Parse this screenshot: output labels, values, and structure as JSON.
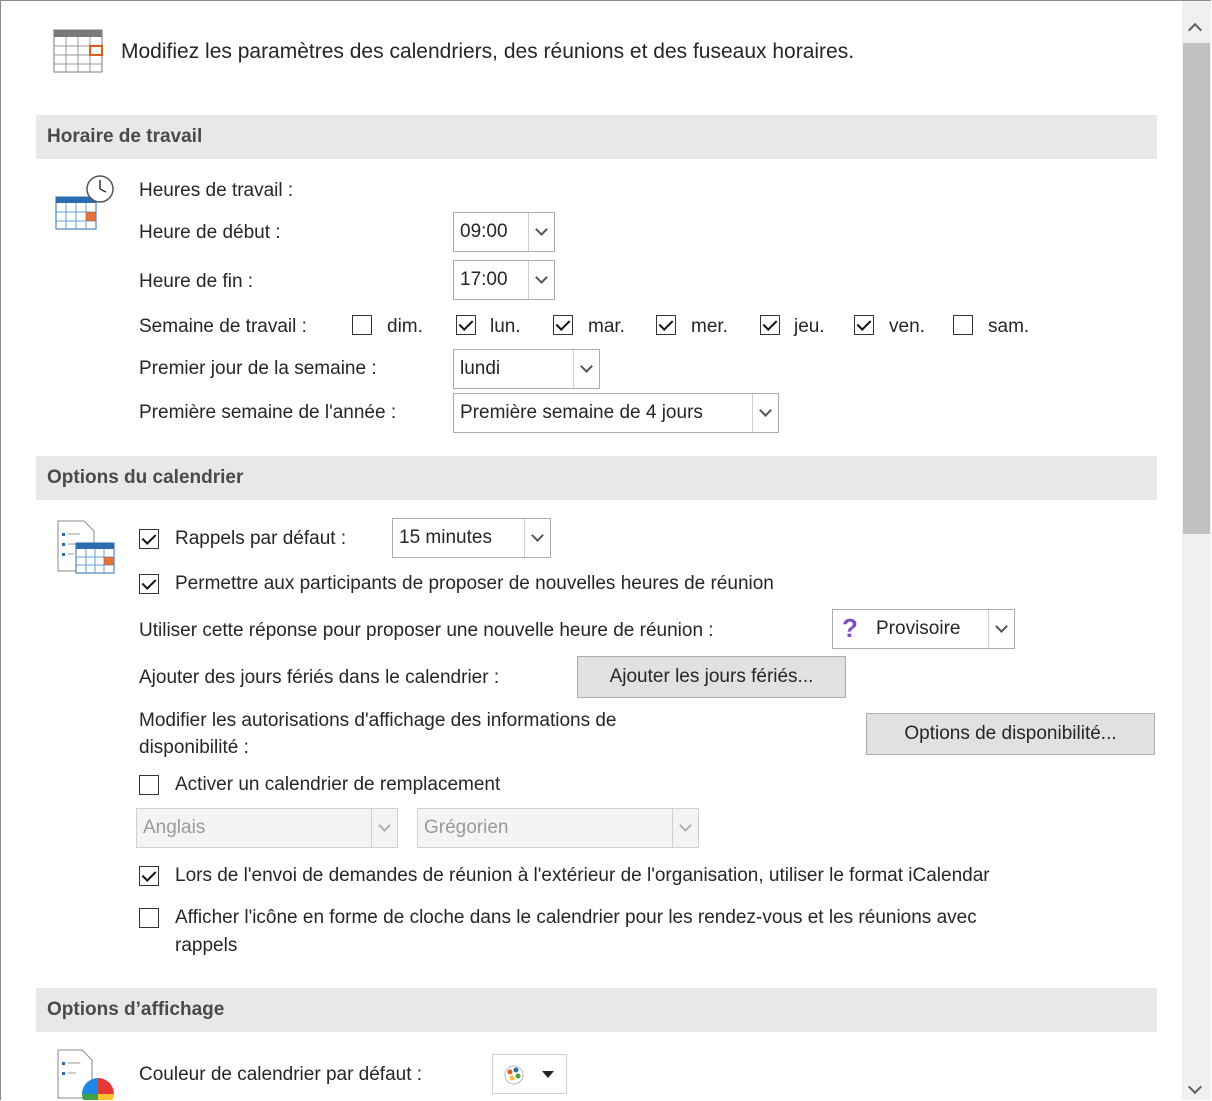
{
  "intro": "Modifiez les paramètres des calendriers, des réunions et des fuseaux horaires.",
  "work": {
    "header": "Horaire de travail",
    "hours_label": "Heures de travail :",
    "start_label": "Heure de début :",
    "start_value": "09:00",
    "end_label": "Heure de fin :",
    "end_value": "17:00",
    "week_label": "Semaine de travail :",
    "days": [
      {
        "label": "dim.",
        "checked": false
      },
      {
        "label": "lun.",
        "checked": true
      },
      {
        "label": "mar.",
        "checked": true
      },
      {
        "label": "mer.",
        "checked": true
      },
      {
        "label": "jeu.",
        "checked": true
      },
      {
        "label": "ven.",
        "checked": true
      },
      {
        "label": "sam.",
        "checked": false
      }
    ],
    "first_day_label": "Premier jour de la semaine :",
    "first_day_value": "lundi",
    "first_week_label": "Première semaine de l'année :",
    "first_week_value": "Première semaine de 4 jours"
  },
  "calendar": {
    "header": "Options du calendrier",
    "reminders_label": "Rappels par défaut :",
    "reminders_checked": true,
    "reminders_value": "15 minutes",
    "propose_label": "Permettre aux participants de proposer de nouvelles heures de réunion",
    "propose_checked": true,
    "response_label": "Utiliser cette réponse pour proposer une nouvelle heure de réunion :",
    "response_value": "Provisoire",
    "holidays_label": "Ajouter des jours fériés dans le calendrier :",
    "holidays_button": "Ajouter les jours fériés...",
    "availability_label_1": "Modifier les autorisations d'affichage des informations de",
    "availability_label_2": "disponibilité :",
    "availability_button": "Options de disponibilité...",
    "alt_calendar_label": "Activer un calendrier de remplacement",
    "alt_calendar_checked": false,
    "alt_language": "Anglais",
    "alt_type": "Grégorien",
    "icalendar_label": "Lors de l'envoi de demandes de réunion à l'extérieur de l'organisation, utiliser le format iCalendar",
    "icalendar_checked": true,
    "bell_label_1": "Afficher l'icône en forme de cloche dans le calendrier pour les rendez-vous et les réunions avec",
    "bell_label_2": "rappels",
    "bell_checked": false
  },
  "display": {
    "header": "Options d’affichage",
    "color_label": "Couleur de calendrier par défaut :"
  },
  "icons": [
    "calendar-grid-icon",
    "calendar-clock-icon",
    "calendar-list-icon",
    "question-icon",
    "color-wheel-icon",
    "chevron-up-icon",
    "chevron-down-icon"
  ]
}
